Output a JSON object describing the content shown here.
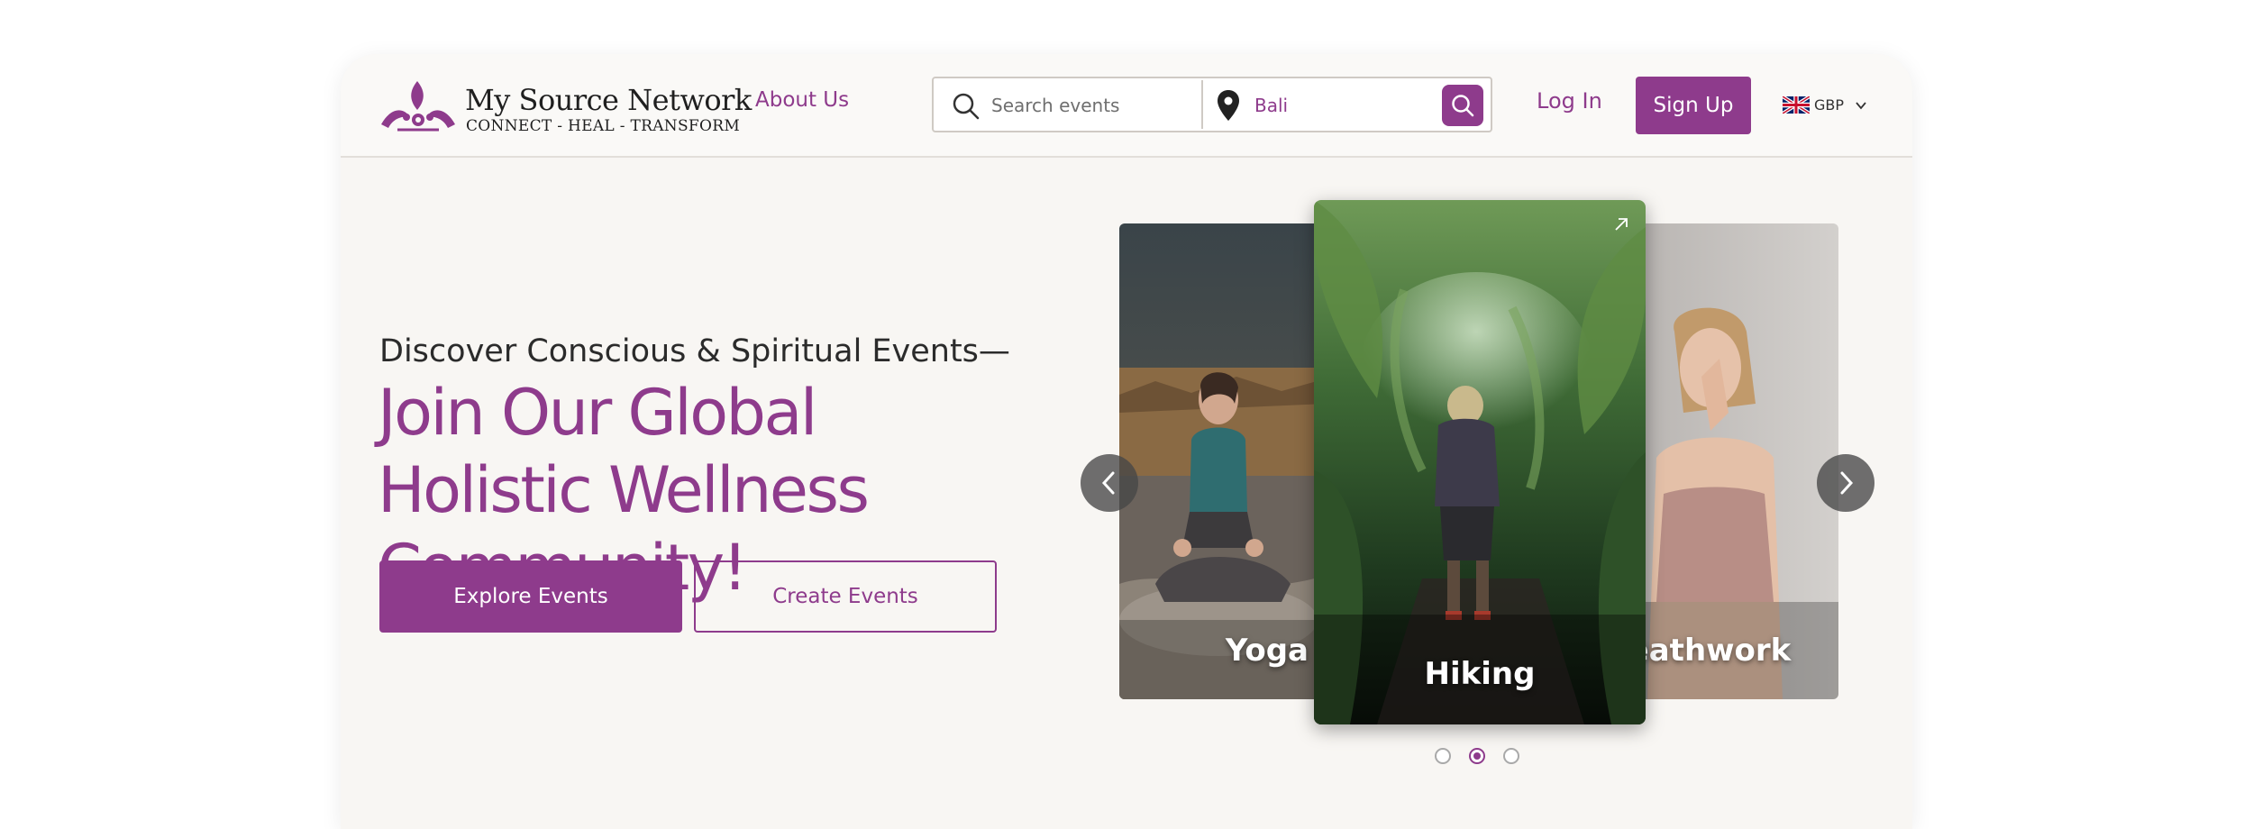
{
  "brand": {
    "name": "My Source Network",
    "tagline": "CONNECT - HEAL - TRANSFORM",
    "accent_color": "#8e3b8c"
  },
  "nav": {
    "about_label": "About Us",
    "login_label": "Log In",
    "signup_label": "Sign Up",
    "currency": "GBP",
    "currency_flag": "uk-flag-icon"
  },
  "search": {
    "query_placeholder": "Search events",
    "location_value": "Bali"
  },
  "hero": {
    "subtitle": "Discover Conscious & Spiritual Events—",
    "title": "Join Our Global Holistic Wellness Community!",
    "explore_label": "Explore Events",
    "create_label": "Create Events"
  },
  "carousel": {
    "cards": [
      {
        "label": "Yoga"
      },
      {
        "label": "Hiking"
      },
      {
        "label": "Breathwork"
      }
    ],
    "active_index": 1,
    "dot_count": 3
  }
}
